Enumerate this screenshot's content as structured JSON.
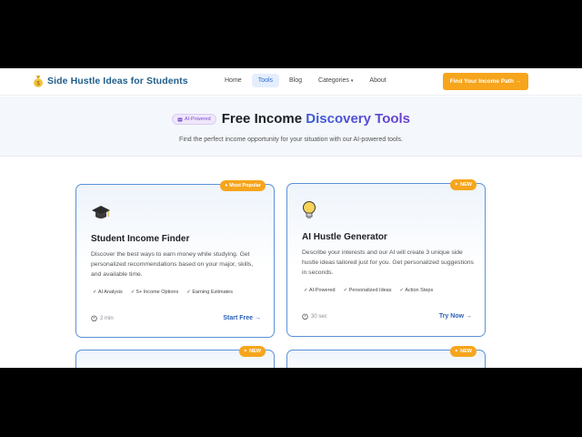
{
  "nav": {
    "brand": "Side Hustle Ideas for Students",
    "links": [
      "Home",
      "Tools",
      "Blog",
      "Categories",
      "About"
    ],
    "categories_caret": "▾",
    "cta": "Find Your Income Path →"
  },
  "hero": {
    "badge": "AI-Powered",
    "title_plain": "Free Income",
    "title_accent": "Discovery Tools",
    "subtitle": "Find the perfect income opportunity for your situation with our AI-powered tools."
  },
  "cards": [
    {
      "ribbon": "Most Popular",
      "title": "Student Income Finder",
      "desc": "Discover the best ways to earn money while studying. Get personalized recommendations based on your major, skills, and available time.",
      "features": [
        "✓ AI Analysis",
        "✓ 5+ Income Options",
        "✓ Earning Estimates"
      ],
      "time": "2 min",
      "action": "Start Free →",
      "icon": "graduation-cap-icon"
    },
    {
      "ribbon": "NEW",
      "title": "AI Hustle Generator",
      "desc": "Describe your interests and our AI will create 3 unique side hustle ideas tailored just for you. Get personalized suggestions in seconds.",
      "features": [
        "✓ AI-Powered",
        "✓ Personalized Ideas",
        "✓ Action Steps"
      ],
      "time": "30 sec",
      "action": "Try Now →",
      "icon": "lightbulb-icon"
    },
    {
      "ribbon": "NEW"
    },
    {
      "ribbon": "NEW"
    }
  ],
  "colors": {
    "accent_orange": "#f6a51c",
    "brand_blue": "#1f5f8b",
    "card_border": "#5a92d6"
  }
}
